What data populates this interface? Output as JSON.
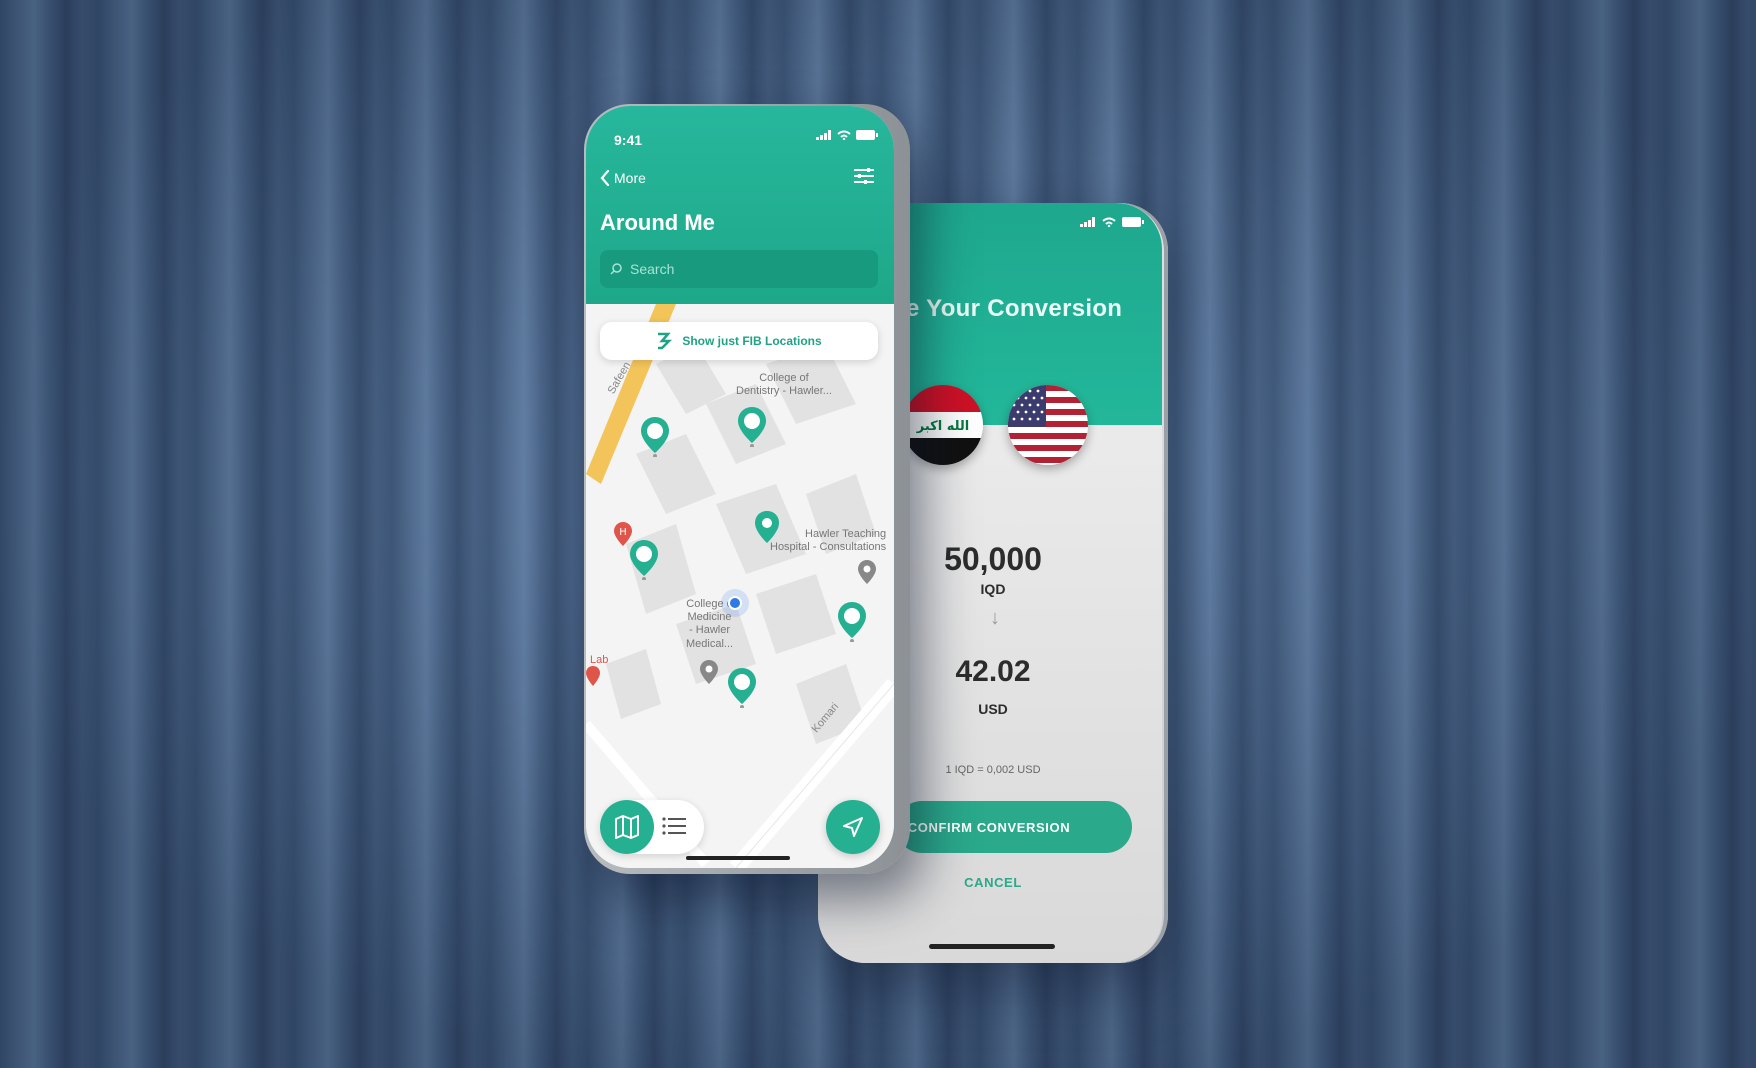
{
  "map_screen": {
    "time": "9:41",
    "back_label": "More",
    "title": "Around Me",
    "search_placeholder": "Search",
    "fib_filter_label": "Show just FIB Locations",
    "labels": {
      "dentistry": "College of\nDentistry - Hawler...",
      "hospital": "Hawler Teaching\nHospital - Consultations",
      "medicine": "College o\nMedicine\n- Hawler\nMedical...",
      "lab": "Lab",
      "road_safeen": "Safeen",
      "road_komari": "Komari"
    },
    "icons": [
      "back-chevron-icon",
      "filter-icon",
      "search-icon",
      "fib-logo-icon",
      "map-icon",
      "list-icon",
      "navigate-icon"
    ]
  },
  "conversion_screen": {
    "title": "e Your Conversion",
    "from_amount": "50,000",
    "from_currency": "IQD",
    "to_amount": "42.02",
    "to_currency": "USD",
    "rate_text": "1 IQD = 0,002 USD",
    "confirm_label": "CONFIRM CONVERSION",
    "cancel_label": "CANCEL"
  },
  "colors": {
    "brand_green": "#25b092",
    "background_blue": "#4d6a8f"
  }
}
